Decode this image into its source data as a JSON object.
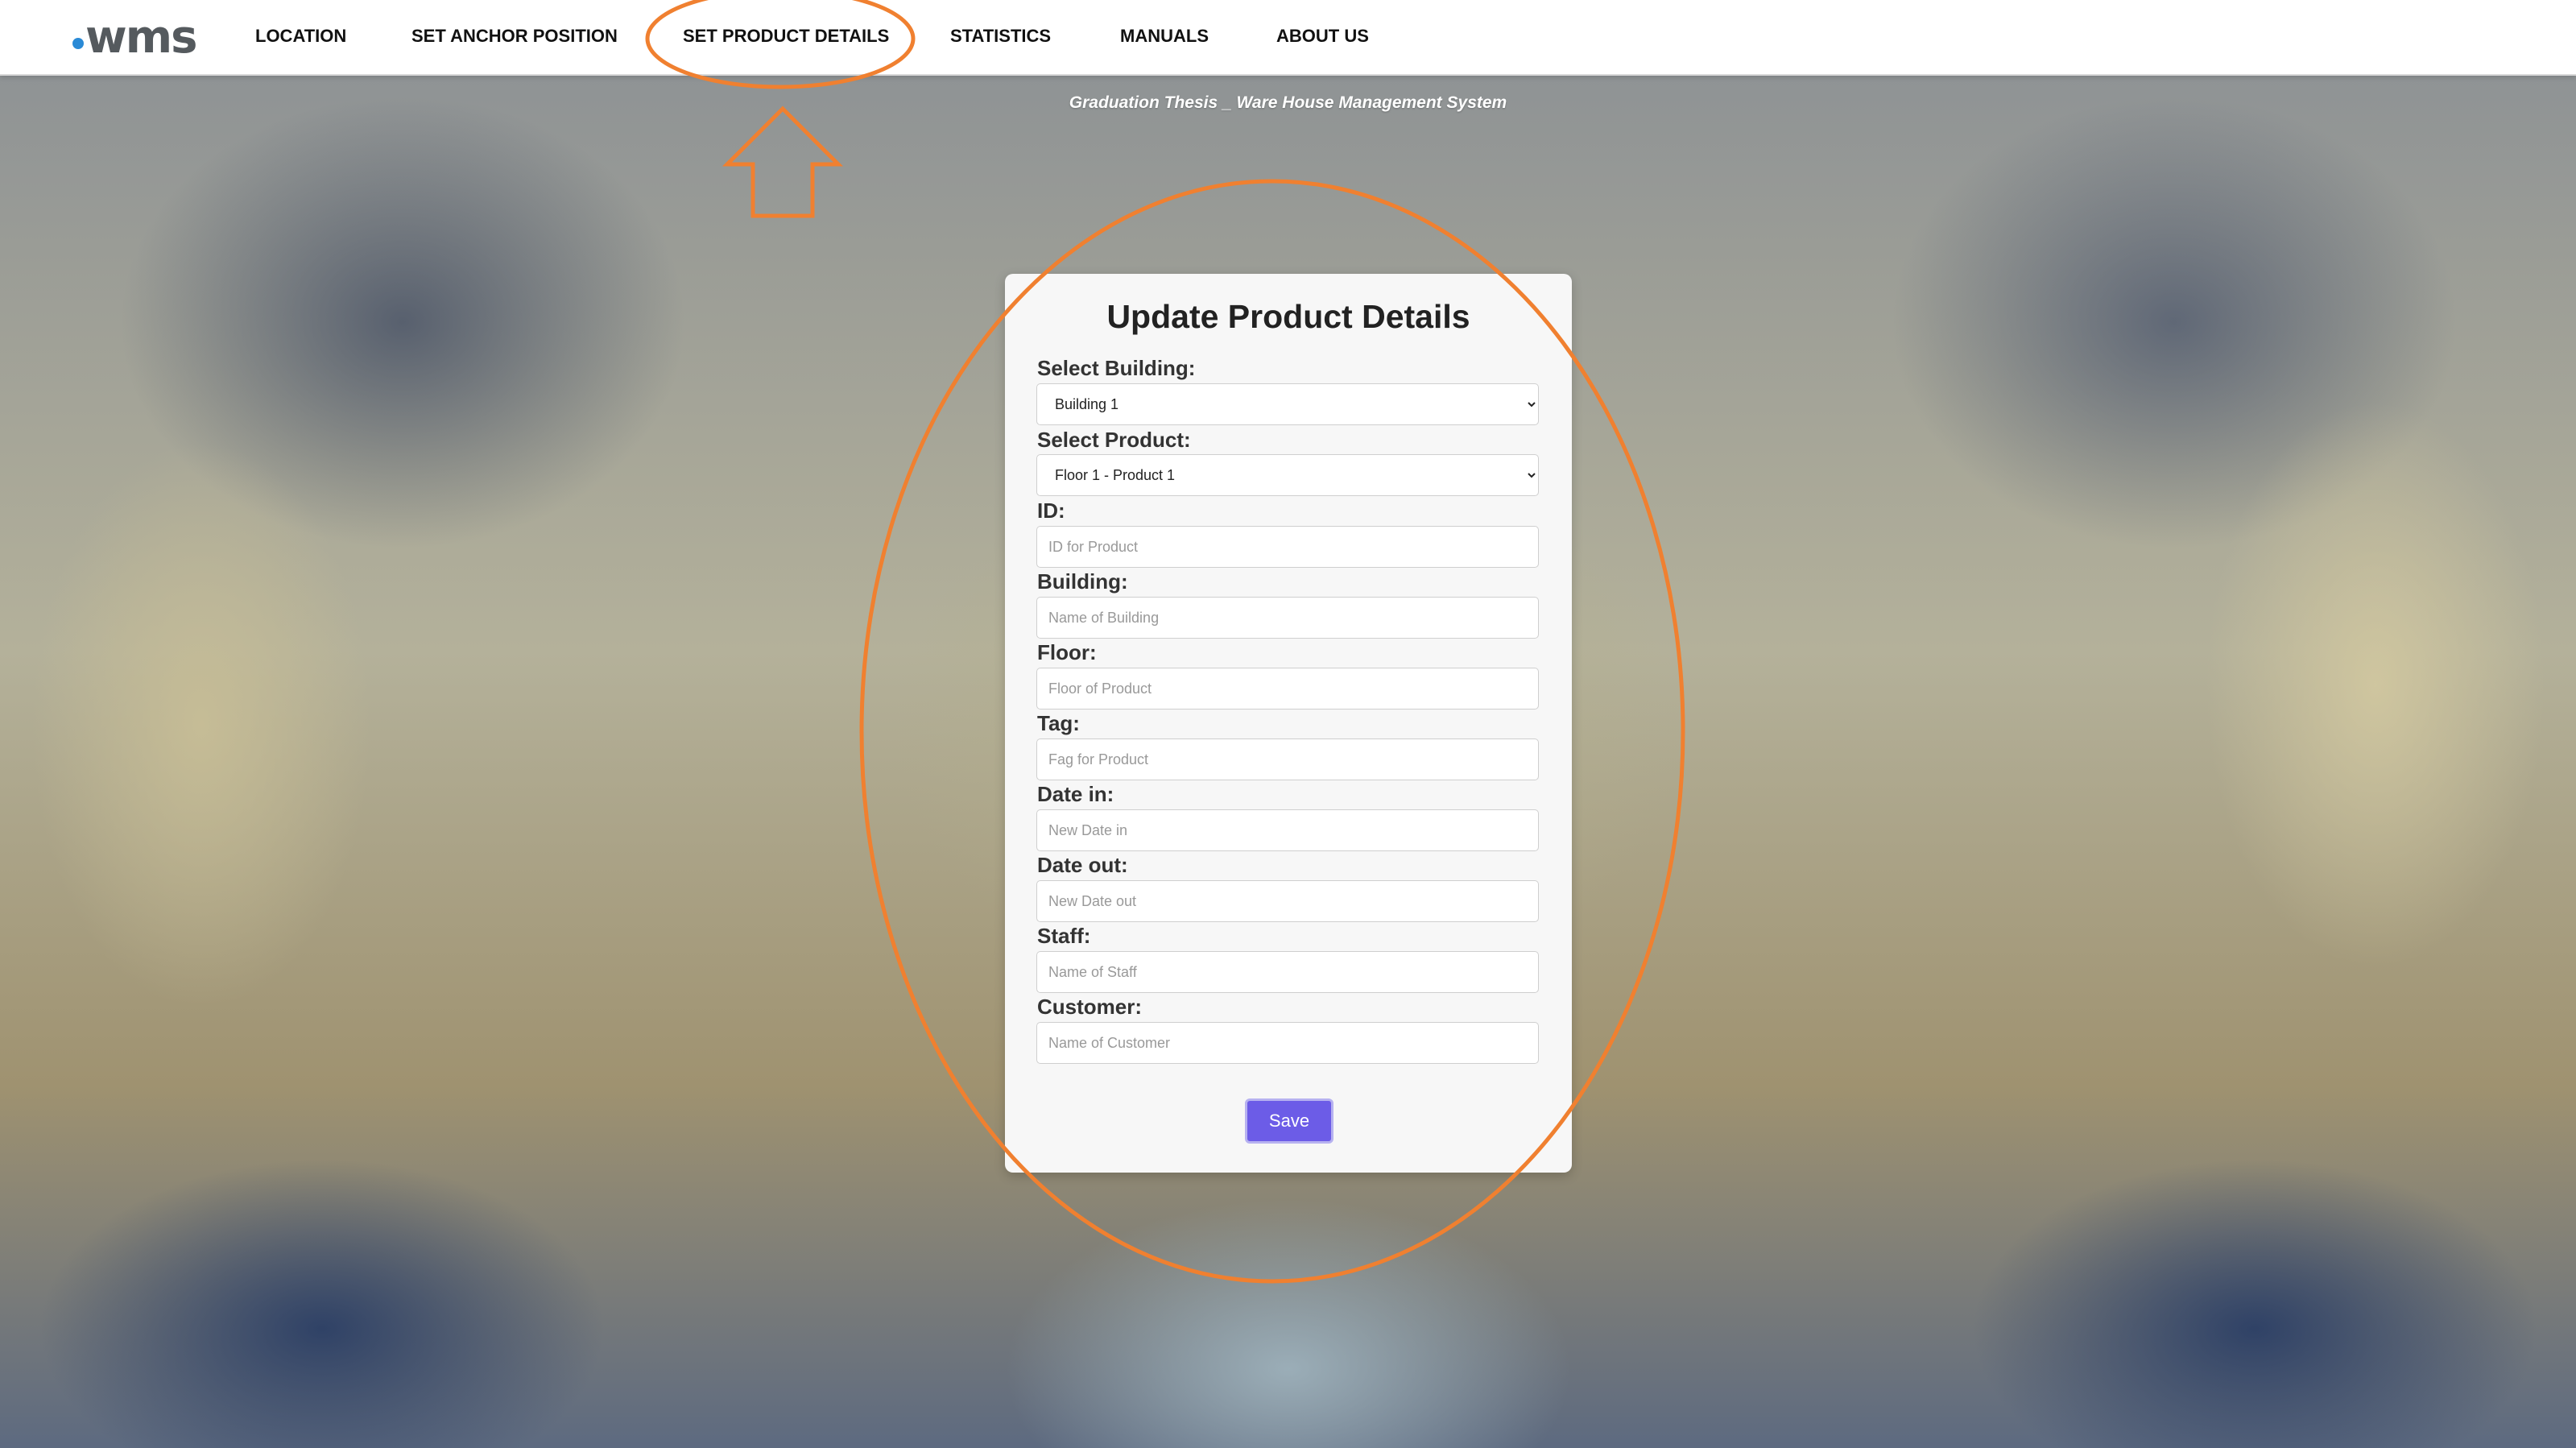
{
  "header": {
    "logo_text": "wms",
    "nav": [
      {
        "label": "LOCATION"
      },
      {
        "label": "SET ANCHOR POSITION"
      },
      {
        "label": "SET PRODUCT DETAILS"
      },
      {
        "label": "STATISTICS"
      },
      {
        "label": "MANUALS"
      },
      {
        "label": "ABOUT US"
      }
    ]
  },
  "subtitle": "Graduation Thesis _ Ware House Management System",
  "form": {
    "title": "Update Product Details",
    "select_building": {
      "label": "Select Building:",
      "value": "Building 1"
    },
    "select_product": {
      "label": "Select Product:",
      "value": "Floor 1 - Product 1"
    },
    "fields": [
      {
        "label": "ID:",
        "placeholder": "ID for Product"
      },
      {
        "label": "Building:",
        "placeholder": "Name of Building"
      },
      {
        "label": "Floor:",
        "placeholder": "Floor of Product"
      },
      {
        "label": "Tag:",
        "placeholder": "Fag for Product"
      },
      {
        "label": "Date in:",
        "placeholder": "New Date in"
      },
      {
        "label": "Date out:",
        "placeholder": "New Date out"
      },
      {
        "label": "Staff:",
        "placeholder": "Name of Staff"
      },
      {
        "label": "Customer:",
        "placeholder": "Name of Customer"
      }
    ],
    "save_label": "Save"
  },
  "colors": {
    "accent_button": "#6c5ce7",
    "annotation": "#f08030",
    "logo_dot": "#2a8ad6"
  }
}
